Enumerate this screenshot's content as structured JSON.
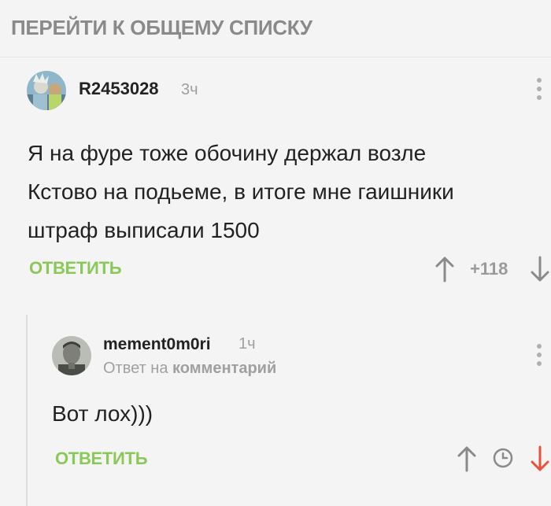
{
  "header": {
    "back_link": "ПЕРЕЙТИ К ОБЩЕМУ СПИСКУ"
  },
  "comment": {
    "author": "R2453028",
    "time": "3ч",
    "lines": [
      "Я на фуре тоже обочину держал возле",
      "Кстово на подьеме, в итоге мне гаишники",
      "штраф выписали 1500"
    ],
    "reply_label": "ОТВЕТИТЬ",
    "rating": "+118"
  },
  "reply": {
    "author": "mement0m0ri",
    "time": "1ч",
    "meta_prefix": "Ответ на",
    "meta_link": "комментарий",
    "text": "Вот лох)))",
    "reply_label": "ОТВЕТИТЬ"
  },
  "icons": {
    "upvote": "arrow-up-icon",
    "downvote": "arrow-down-icon",
    "more": "more-vertical-icon",
    "clock": "clock-icon"
  },
  "colors": {
    "accent_green": "#8ac858",
    "downvote_active": "#e8523a",
    "muted_gray": "#8a8a8a",
    "background": "#f4f4f4"
  }
}
